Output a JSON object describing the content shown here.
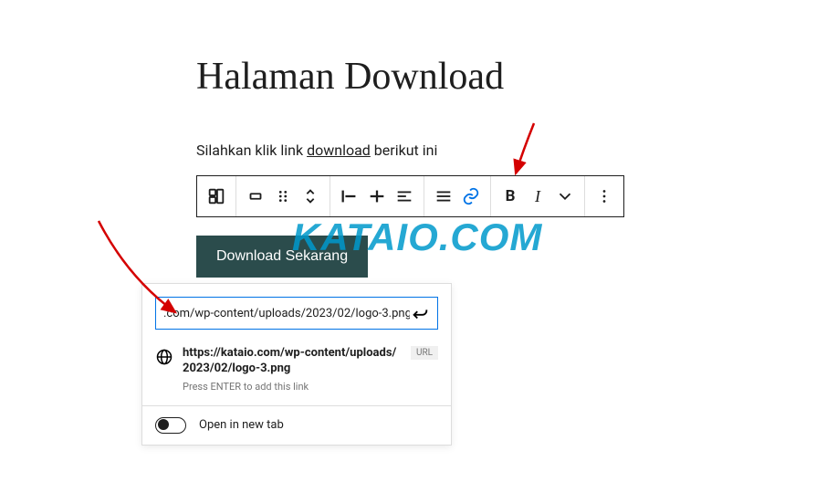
{
  "title": "Halaman Download",
  "intro": {
    "before": "Silahkan klik link ",
    "link_word": "download",
    "after": " berikut ini"
  },
  "button_label": "Download Sekarang",
  "watermark": "KATAIO.COM",
  "link_popover": {
    "input_value": ".com/wp-content/uploads/2023/02/logo-3.png",
    "suggestion_url": "https://kataio.com/wp-content/uploads/2023/02/logo-3.png",
    "suggestion_hint": "Press ENTER to add this link",
    "url_badge": "URL",
    "toggle_label": "Open in new tab"
  }
}
